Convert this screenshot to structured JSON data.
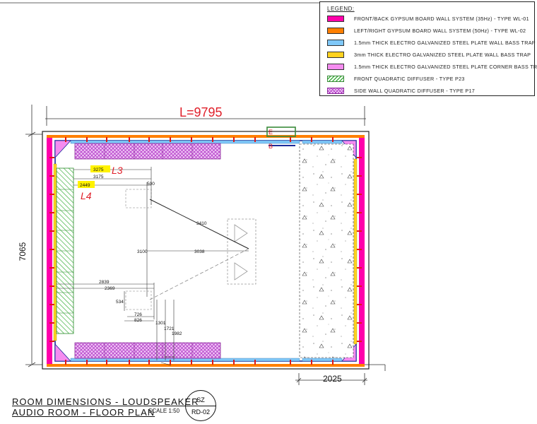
{
  "legend": {
    "title": "LEGEND:",
    "items": [
      {
        "label": "FRONT/BACK GYPSUM BOARD WALL SYSTEM (35Hz) - TYPE WL-01",
        "color": "#ff00aa",
        "pattern": "solid"
      },
      {
        "label": "LEFT/RIGHT GYPSUM BOARD WALL SYSTEM (50Hz) - TYPE WL-02",
        "color": "#ff7f00",
        "pattern": "solid"
      },
      {
        "label": "1.5mm THICK ELECTRO GALVANIZED STEEL PLATE WALL BASS TRAP",
        "color": "#7fc8f8",
        "pattern": "solid"
      },
      {
        "label": "3mm THICK ELECTRO GALVANIZED STEEL PLATE WALL BASS TRAP",
        "color": "#ffd21f",
        "pattern": "solid"
      },
      {
        "label": "1.5mm THICK ELECTRO GALVANIZED STEEL PLATE CORNER BASS TRAP",
        "color": "#f58cf0",
        "pattern": "solid"
      },
      {
        "label": "FRONT QUADRATIC DIFFUSER - TYPE P23",
        "color": "#3fb03f",
        "pattern": "hatch"
      },
      {
        "label": "SIDE WALL QUADRATIC DIFFUSER - TYPE P17",
        "color": "#b43ec9",
        "pattern": "crosshatch"
      }
    ]
  },
  "plan": {
    "overall_width_label": "L=9795",
    "overall_height_label": "7065",
    "right_zone_label": "2025",
    "dimensions": {
      "d3275": "3275",
      "d3175": "3175",
      "d2449": "2449",
      "d500": "500",
      "d3410": "3410",
      "d3100": "3100",
      "d3038": "3038",
      "d2839": "2839",
      "d2369": "2369",
      "d534": "534",
      "d726": "726",
      "d826": "826",
      "d1301": "1301",
      "d1721": "1721",
      "d1982": "1982"
    },
    "annotations": {
      "l3": "L3",
      "l4": "L4",
      "e": "E",
      "b": "B"
    }
  },
  "title_block": {
    "line1": "ROOM DIMENSIONS - LOUDSPEAKER",
    "line2": "AUDIO ROOM - FLOOR PLAN",
    "scale": "SCALE 1:50",
    "stamp_top": "SZ",
    "stamp_bottom": "RD-02"
  }
}
